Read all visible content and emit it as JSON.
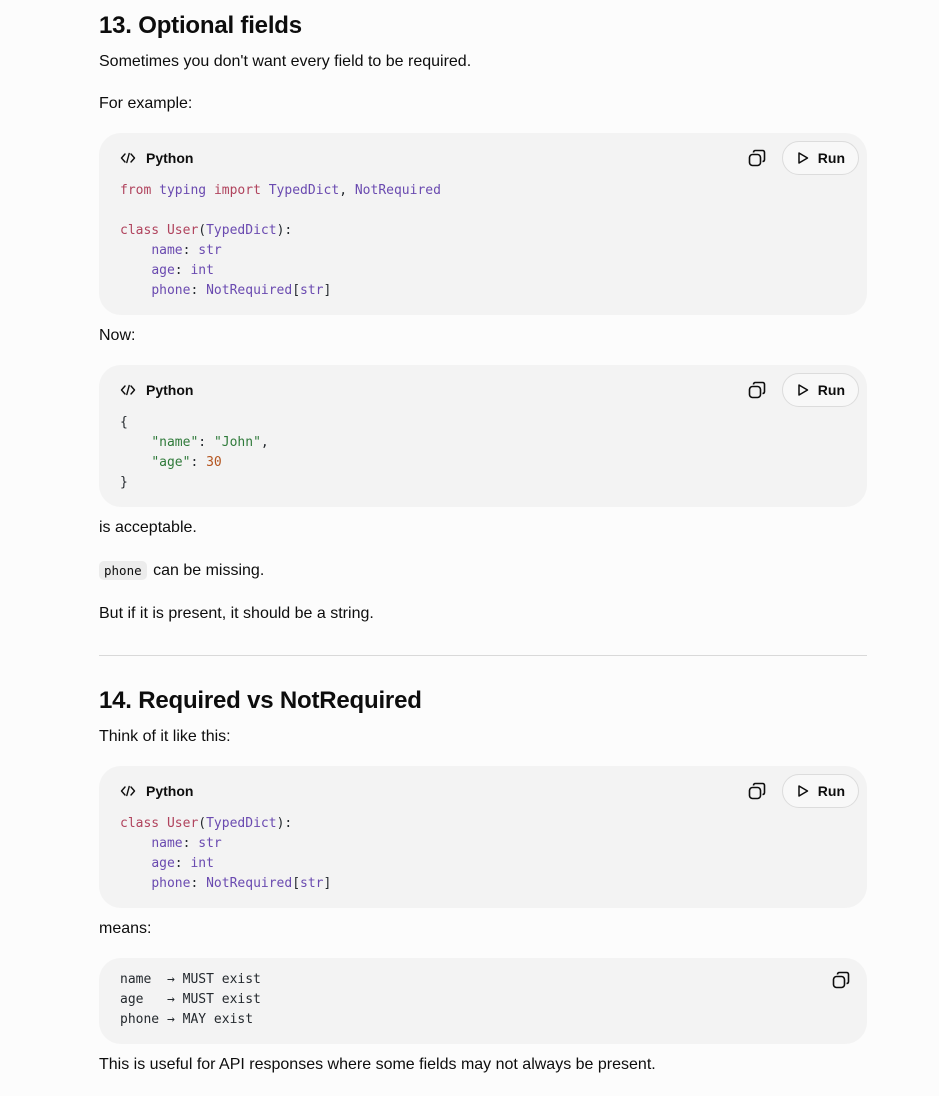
{
  "section13": {
    "title": "13. Optional fields",
    "intro": "Sometimes you don't want every field to be required.",
    "example_label": "For example:",
    "code1": {
      "lang": "Python",
      "run_label": "Run",
      "lines": {
        "l1_kw_from": "from",
        "l1_mod": "typing",
        "l1_kw_import": "import",
        "l1_t1": "TypedDict",
        "l1_sep": ", ",
        "l1_t2": "NotRequired",
        "l3_kw_class": "class",
        "l3_cls": "User",
        "l3_open": "(",
        "l3_base": "TypedDict",
        "l3_close": "):",
        "l4_name": "name",
        "l4_colon": ": ",
        "l4_type": "str",
        "l5_name": "age",
        "l5_colon": ": ",
        "l5_type": "int",
        "l6_name": "phone",
        "l6_colon": ": ",
        "l6_type": "NotRequired",
        "l6_open": "[",
        "l6_inner": "str",
        "l6_close": "]"
      }
    },
    "now_label": "Now:",
    "code2": {
      "lang": "Python",
      "run_label": "Run",
      "lines": {
        "open_brace": "{",
        "k1": "\"name\"",
        "k1_sep": ": ",
        "v1": "\"John\"",
        "v1_comma": ",",
        "k2": "\"age\"",
        "k2_sep": ": ",
        "v2": "30",
        "close_brace": "}"
      }
    },
    "acceptable": "is acceptable.",
    "phone_code": "phone",
    "missing": "can be missing.",
    "present": "But if it is present, it should be a string."
  },
  "section14": {
    "title": "14. Required vs NotRequired",
    "intro": "Think of it like this:",
    "code3": {
      "lang": "Python",
      "run_label": "Run",
      "lines": {
        "l1_kw_class": "class",
        "l1_cls": "User",
        "l1_open": "(",
        "l1_base": "TypedDict",
        "l1_close": "):",
        "l2_name": "name",
        "l2_colon": ": ",
        "l2_type": "str",
        "l3_name": "age",
        "l3_colon": ": ",
        "l3_type": "int",
        "l4_name": "phone",
        "l4_colon": ": ",
        "l4_type": "NotRequired",
        "l4_open": "[",
        "l4_inner": "str",
        "l4_close": "]"
      }
    },
    "means": "means:",
    "code4": {
      "lines": [
        "name  → MUST exist",
        "age   → MUST exist",
        "phone → MAY exist"
      ]
    },
    "useful": "This is useful for API responses where some fields may not always be present."
  },
  "colors": {
    "keyword": "#b0435d",
    "type": "#6a4ab0",
    "string": "#2f7a3a",
    "number": "#b4551f",
    "code_bg": "#f3f3f3"
  },
  "icons": {
    "lang": "code-brackets-icon",
    "copy": "copy-icon",
    "run": "play-icon"
  }
}
